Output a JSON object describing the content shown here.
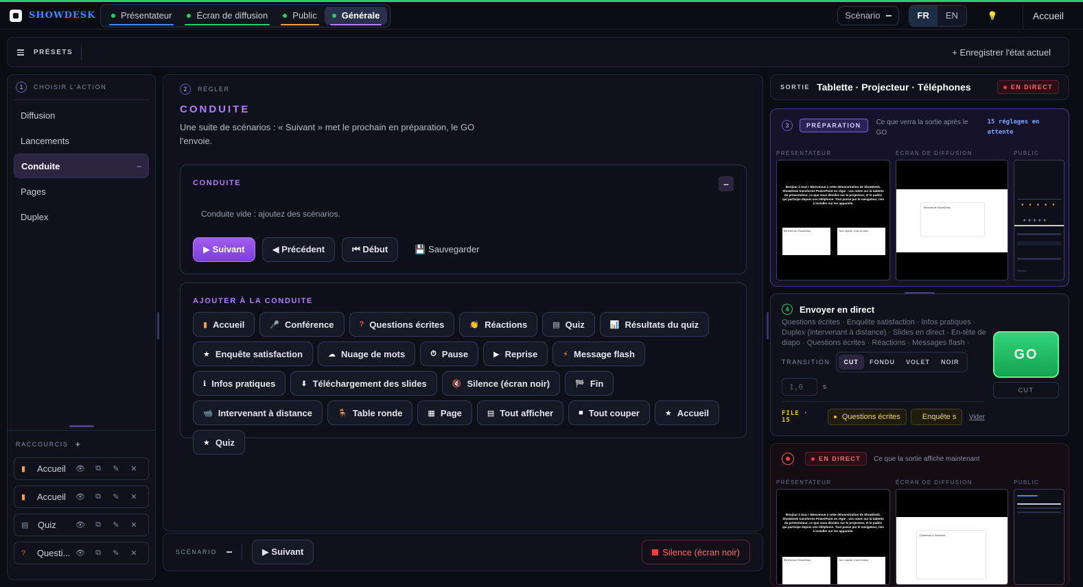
{
  "app": {
    "name": "SHOWDESK"
  },
  "modes": [
    {
      "label": "Présentateur",
      "color": "#3a8bff"
    },
    {
      "label": "Écran de diffusion",
      "color": "#23d160"
    },
    {
      "label": "Public",
      "color": "#f59e42"
    },
    {
      "label": "Générale",
      "color": "#b57cff",
      "active": true
    }
  ],
  "topbar": {
    "scenario_label": "Scénario",
    "lang_fr": "FR",
    "lang_en": "EN",
    "home": "Accueil"
  },
  "presets": {
    "label": "PRÉSETS",
    "save": "+ Enregistrer l'état actuel"
  },
  "step1": {
    "num": "1",
    "label": "CHOISIR L'ACTION"
  },
  "nav": [
    {
      "label": "Diffusion"
    },
    {
      "label": "Lancements"
    },
    {
      "label": "Conduite",
      "active": true,
      "mark": "–"
    },
    {
      "label": "Pages"
    },
    {
      "label": "Duplex"
    }
  ],
  "shortcuts": {
    "label": "RACCOURCIS",
    "plus": "+",
    "items": [
      {
        "icon": "▮",
        "color": "#f59e42",
        "label": "Accueil"
      },
      {
        "icon": "▮",
        "color": "#f59e42",
        "label": "Accueil"
      },
      {
        "icon": "▤",
        "color": "#8a8fa3",
        "label": "Quiz"
      },
      {
        "icon": "?",
        "color": "#ff4d4d",
        "label": "Questi..."
      }
    ]
  },
  "step2": {
    "num": "2",
    "label": "RÉGLER"
  },
  "conduite": {
    "title": "CONDUITE",
    "desc": "Une suite de scénarios : « Suivant » met le prochain en préparation, le GO l'envoie.",
    "card_title": "CONDUITE",
    "collapse": "–",
    "empty": "Conduite vide : ajoutez des scénarios.",
    "btn_next": "▶ Suivant",
    "btn_prev": "◀ Précédent",
    "btn_start": "⏮ Début",
    "btn_save": "💾 Sauvegarder"
  },
  "add": {
    "title": "AJOUTER À LA CONDUITE",
    "items": [
      {
        "icon": "▮",
        "color": "#f59e42",
        "label": "Accueil"
      },
      {
        "icon": "🎤",
        "color": "#c9ccd8",
        "label": "Conférence"
      },
      {
        "icon": "?",
        "color": "#ff4d4d",
        "label": "Questions écrites"
      },
      {
        "icon": "👏",
        "color": "#f5c518",
        "label": "Réactions"
      },
      {
        "icon": "▤",
        "color": "#c9ccd8",
        "label": "Quiz"
      },
      {
        "icon": "📊",
        "color": "#7aa8ff",
        "label": "Résultats du quiz"
      },
      {
        "icon": "★",
        "color": "#fff",
        "label": "Enquête satisfaction"
      },
      {
        "icon": "☁",
        "color": "#fff",
        "label": "Nuage de mots"
      },
      {
        "icon": "⏱",
        "color": "#fff",
        "label": "Pause"
      },
      {
        "icon": "▶",
        "color": "#fff",
        "label": "Reprise"
      },
      {
        "icon": "⚡",
        "color": "#f59e42",
        "label": "Message flash"
      },
      {
        "icon": "ℹ",
        "color": "#fff",
        "label": "Infos pratiques"
      },
      {
        "icon": "⬇",
        "color": "#fff",
        "label": "Téléchargement des slides"
      },
      {
        "icon": "🔇",
        "color": "#ff6a6a",
        "label": "Silence (écran noir)"
      },
      {
        "icon": "🏁",
        "color": "#fff",
        "label": "Fin"
      },
      {
        "icon": "📹",
        "color": "#c9ccd8",
        "label": "Intervenant à distance"
      },
      {
        "icon": "🪑",
        "color": "#f59e42",
        "label": "Table ronde"
      },
      {
        "icon": "▦",
        "color": "#fff",
        "label": "Page"
      },
      {
        "icon": "▤",
        "color": "#fff",
        "label": "Tout afficher"
      },
      {
        "icon": "■",
        "color": "#fff",
        "label": "Tout couper"
      },
      {
        "icon": "★",
        "color": "#fff",
        "label": "Accueil"
      },
      {
        "icon": "★",
        "color": "#fff",
        "label": "Quiz"
      }
    ]
  },
  "bottom": {
    "label": "SCÉNARIO",
    "next": "▶ Suivant",
    "silence": "Silence (écran noir)"
  },
  "sortie": {
    "label": "SORTIE",
    "value": "Tablette · Projecteur · Téléphones",
    "live": "EN DIRECT"
  },
  "prep": {
    "num": "3",
    "badge": "PRÉPARATION",
    "note": "Ce que verra la sortie après le GO",
    "pending": "15 réglages en attente",
    "screens": [
      "PRÉSENTATEUR",
      "ÉCRAN DE DIFFUSION",
      "PUBLIC"
    ],
    "slide_text": "Bonjour à tous ! Bienvenue à cette démonstration de ShowDesk. ShowDesk transforme PowerPoint en régie : vos notes sur la tablette du présentateur, ce que vous décidez sur le projecteur, et le public qui participe depuis son téléphone. Tout passe par le navigateur, rien à installer sur les appareils.",
    "slide_title": "Bienvenue ShowDesk",
    "thumb2_title": "Tour rapide, trois rendus"
  },
  "envoyer": {
    "num": "4",
    "title": "Envoyer en direct",
    "list": "Questions écrites · Enquête satisfaction · Infos pratiques · Duplex (intervenant à distance) · Slides en direct · En-tête de diapo · Questions écrites · Réactions · Messages flash · Time...",
    "transition_label": "TRANSITION",
    "transitions": [
      {
        "label": "CUT",
        "active": true
      },
      {
        "label": "FONDU"
      },
      {
        "label": "VOLET"
      },
      {
        "label": "NOIR"
      }
    ],
    "duration": "1,0",
    "unit": "s",
    "file_label": "FILE · 15",
    "queue": [
      "Questions écrites",
      "Enquête s"
    ],
    "clear": "Vider",
    "go": "GO",
    "cut": "CUT"
  },
  "direct": {
    "badge": "EN DIRECT",
    "note": "Ce que la sortie affiche maintenant",
    "screens": [
      "PRÉSENTATEUR",
      "ÉCRAN DE DIFFUSION",
      "PUBLIC"
    ],
    "slide_title": "Bienvenue ShowDesk",
    "thumb2_title": "Tour rapide, trois rendus",
    "tv_title": "Contenus à l'intérieur"
  }
}
